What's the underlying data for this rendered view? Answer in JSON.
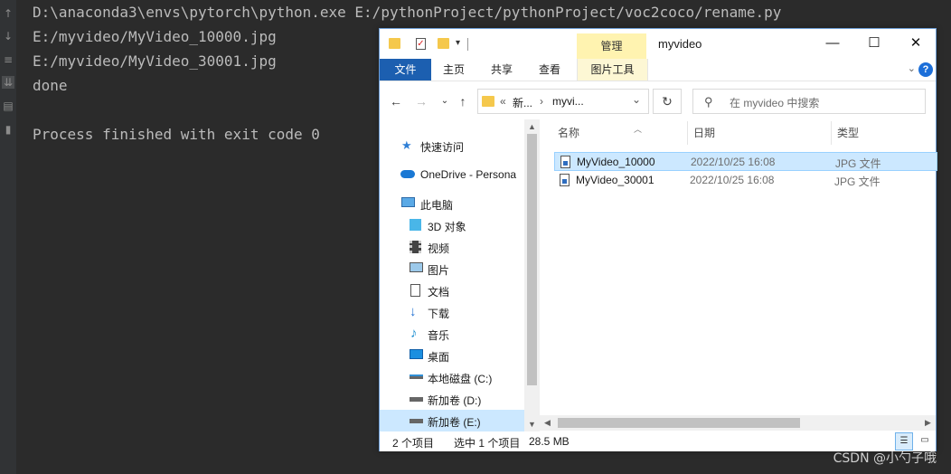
{
  "ide": {
    "gutter_icons": [
      "up-arrow-icon",
      "down-arrow-icon",
      "soft-wrap-icon",
      "scroll-to-end-icon",
      "print-icon",
      "trash-icon"
    ],
    "lines": [
      "D:\\anaconda3\\envs\\pytorch\\python.exe E:/pythonProject/pythonProject/voc2coco/rename.py",
      "E:/myvideo/MyVideo_10000.jpg",
      "E:/myvideo/MyVideo_30001.jpg",
      "done",
      "",
      "Process finished with exit code 0"
    ]
  },
  "explorer": {
    "title": "myvideo",
    "context_tab": "管理",
    "window_controls": {
      "minimize": "—",
      "maximize": "☐",
      "close": "✕"
    },
    "ribbon_tabs": [
      "文件",
      "主页",
      "共享",
      "查看",
      "图片工具"
    ],
    "address": {
      "prefix": "«",
      "segment1": "新...",
      "separator": "›",
      "segment2": "myvi...",
      "chevron": "⌄"
    },
    "search_placeholder": "在 myvideo 中搜索",
    "nav_items": [
      {
        "label": "快速访问",
        "icon": "star-icon"
      },
      {
        "label": "OneDrive - Persona",
        "icon": "cloud-icon"
      },
      {
        "label": "此电脑",
        "icon": "computer-icon"
      },
      {
        "label": "3D 对象",
        "icon": "cube-icon"
      },
      {
        "label": "视频",
        "icon": "video-icon"
      },
      {
        "label": "图片",
        "icon": "picture-icon"
      },
      {
        "label": "文档",
        "icon": "document-icon"
      },
      {
        "label": "下载",
        "icon": "download-icon"
      },
      {
        "label": "音乐",
        "icon": "music-icon"
      },
      {
        "label": "桌面",
        "icon": "desktop-icon"
      },
      {
        "label": "本地磁盘 (C:)",
        "icon": "system-drive-icon"
      },
      {
        "label": "新加卷 (D:)",
        "icon": "drive-icon"
      },
      {
        "label": "新加卷 (E:)",
        "icon": "drive-icon"
      }
    ],
    "columns": [
      "名称",
      "日期",
      "类型"
    ],
    "files": [
      {
        "name": "MyVideo_10000",
        "date": "2022/10/25 16:08",
        "type": "JPG 文件",
        "selected": true
      },
      {
        "name": "MyVideo_30001",
        "date": "2022/10/25 16:08",
        "type": "JPG 文件",
        "selected": false
      }
    ],
    "status": {
      "count": "2 个项目",
      "selection": "选中 1 个项目",
      "size": "28.5 MB"
    }
  },
  "watermark": "CSDN @小勺子哦",
  "colors": {
    "ide_bg": "#2b2b2b",
    "console_text": "#bbbbbb",
    "file_tab": "#1c5fb0",
    "selection": "#cce8ff",
    "context_tab": "#fff3b0"
  }
}
